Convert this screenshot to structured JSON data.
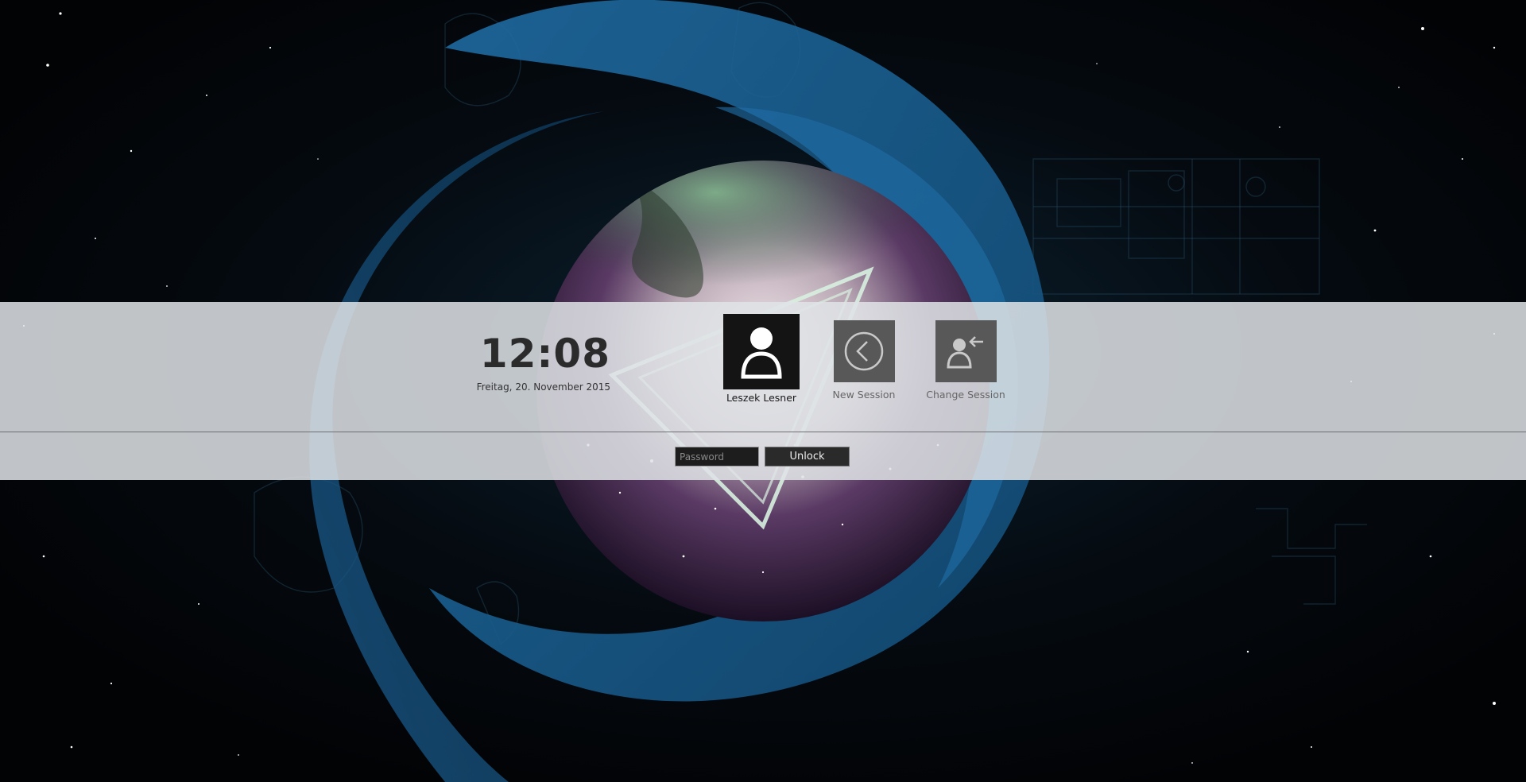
{
  "clock": {
    "time": "12:08",
    "date": "Freitag, 20. November 2015"
  },
  "users": [
    {
      "name": "Leszek Lesner",
      "icon": "user-avatar-icon",
      "selected": true
    }
  ],
  "actions": {
    "new_session": {
      "label": "New Session",
      "icon": "circle-chevron-left-icon"
    },
    "change_session": {
      "label": "Change Session",
      "icon": "user-switch-icon"
    }
  },
  "login": {
    "password_placeholder": "Password",
    "unlock_label": "Unlock"
  },
  "colors": {
    "panel": "#e0e3e6",
    "tile_selected": "#141414",
    "tile_action": "#585858",
    "swirl_blue": "#1a5a88"
  }
}
